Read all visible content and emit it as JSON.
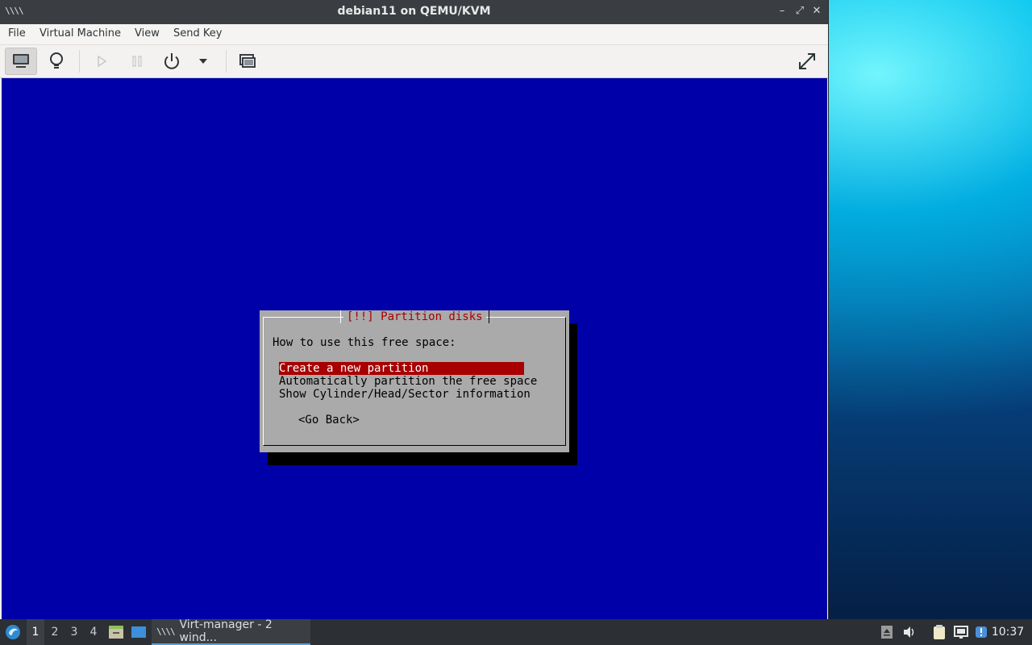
{
  "window": {
    "title": "debian11 on QEMU/KVM",
    "controls": {
      "minimize": "–",
      "maximize": "⤢",
      "close": "✕"
    }
  },
  "menubar": {
    "items": [
      "File",
      "Virtual Machine",
      "View",
      "Send Key"
    ]
  },
  "toolbar": {
    "buttons": [
      "console-icon",
      "lightbulb-details-icon",
      "run-icon",
      "pause-icon",
      "power-icon",
      "chevron-down-icon",
      "snapshots-icon",
      "fullscreen-icon"
    ]
  },
  "installer": {
    "dialog_title": "[!!] Partition disks",
    "prompt": "How to use this free space:",
    "options": [
      "Create a new partition",
      "Automatically partition the free space",
      "Show Cylinder/Head/Sector information"
    ],
    "selected_index": 0,
    "go_back": "<Go Back>",
    "colors": {
      "background": "#0000a8",
      "dialog": "#aaaaaa",
      "highlight": "#a80000",
      "title": "#a80000"
    }
  },
  "taskbar": {
    "workspaces": [
      "1",
      "2",
      "3",
      "4"
    ],
    "active_workspace": "1",
    "task_label": "Virt-manager - 2 wind...",
    "clock": "10:37"
  }
}
